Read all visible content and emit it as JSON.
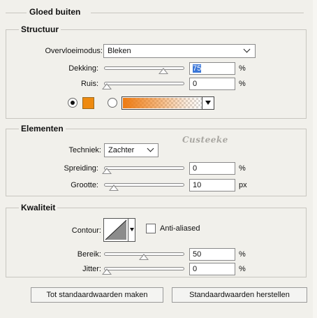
{
  "title": "Gloed buiten",
  "structure": {
    "legend": "Structuur",
    "blend_mode_label": "Overvloeimodus:",
    "blend_mode_value": "Bleken",
    "opacity_label": "Dekking:",
    "opacity_value": "75",
    "opacity_unit": "%",
    "noise_label": "Ruis:",
    "noise_value": "0",
    "noise_unit": "%",
    "color_swatch": "#ee8a10",
    "gradient_start": "#ee7a10",
    "selected_fill": "color"
  },
  "elements": {
    "legend": "Elementen",
    "watermark": "Custeeke",
    "technique_label": "Techniek:",
    "technique_value": "Zachter",
    "spread_label": "Spreiding:",
    "spread_value": "0",
    "spread_unit": "%",
    "size_label": "Grootte:",
    "size_value": "10",
    "size_unit": "px"
  },
  "quality": {
    "legend": "Kwaliteit",
    "contour_label": "Contour:",
    "antialiased_label": "Anti-aliased",
    "antialiased_checked": false,
    "range_label": "Bereik:",
    "range_value": "50",
    "range_unit": "%",
    "jitter_label": "Jitter:",
    "jitter_value": "0",
    "jitter_unit": "%"
  },
  "buttons": {
    "make_default": "Tot standaardwaarden maken",
    "reset_default": "Standaardwaarden herstellen"
  },
  "colors": {
    "accent_selection": "#3a76d8",
    "panel_bg": "#f1f0eb"
  }
}
